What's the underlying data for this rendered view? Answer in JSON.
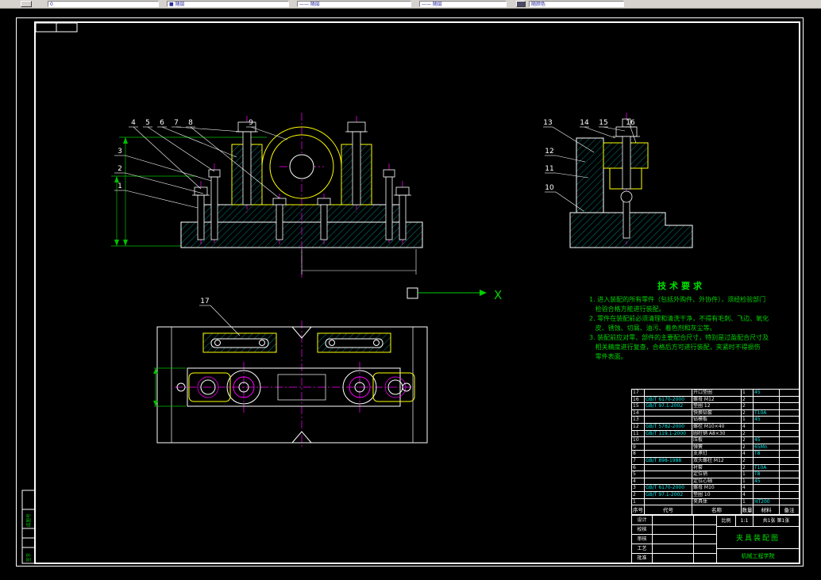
{
  "toolbar": {
    "layer": "0",
    "color": "■ 随层",
    "linetype": "—— 随层",
    "lineweight": "—— 随层",
    "plotstyle": "随颜色"
  },
  "ucs": {
    "x_label": "X"
  },
  "colors": {
    "outline": "#ffffff",
    "part": "#ffff00",
    "hatch": "#00e5e5",
    "centerline": "#ff00ff",
    "annotation": "#00d000"
  },
  "callouts": {
    "front": [
      "1",
      "2",
      "3",
      "4",
      "5",
      "6",
      "7",
      "8",
      "9"
    ],
    "side": [
      "10",
      "11",
      "12",
      "13",
      "14",
      "15",
      "16"
    ],
    "plan": [
      "17"
    ]
  },
  "tech": {
    "title": "技术要求",
    "lines": [
      "1. 进入装配的所有零件（包括外购件、外协件），须经检验部门",
      "   检验合格方能进行装配。",
      "2. 零件在装配前必须清理和清洗干净，不得有毛刺、飞边、氧化",
      "   皮、锈蚀、切屑、油污、着色剂和灰尘等。",
      "3. 装配前应对零、部件的主要配合尺寸，特别是过盈配合尺寸及",
      "   相关精度进行复查，合格后方可进行装配，夹紧时不得损伤",
      "   零件表面。"
    ]
  },
  "bom": {
    "headers": [
      "序号",
      "代号",
      "名称",
      "数量",
      "材料",
      "备注"
    ],
    "rows": [
      [
        "17",
        "",
        "开口垫圈",
        "1",
        "45",
        ""
      ],
      [
        "16",
        "GB/T 6170-2000",
        "螺母 M12",
        "2",
        "",
        ""
      ],
      [
        "15",
        "GB/T 97.1-2002",
        "垫圈 12",
        "2",
        "",
        ""
      ],
      [
        "14",
        "",
        "快换钻套",
        "2",
        "T10A",
        ""
      ],
      [
        "13",
        "",
        "钻模板",
        "1",
        "45",
        ""
      ],
      [
        "12",
        "GB/T 5782-2000",
        "螺栓 M10×40",
        "4",
        "",
        ""
      ],
      [
        "11",
        "GB/T 119.1-2000",
        "圆柱销 A8×30",
        "2",
        "",
        ""
      ],
      [
        "10",
        "",
        "压板",
        "2",
        "45",
        ""
      ],
      [
        "9",
        "",
        "弹簧",
        "2",
        "65Mn",
        ""
      ],
      [
        "8",
        "",
        "支承钉",
        "4",
        "T8",
        ""
      ],
      [
        "7",
        "GB/T 898-1988",
        "双头螺柱 M12",
        "2",
        "",
        ""
      ],
      [
        "6",
        "",
        "衬套",
        "2",
        "T10A",
        ""
      ],
      [
        "5",
        "",
        "定位销",
        "1",
        "T8",
        ""
      ],
      [
        "4",
        "",
        "定位心轴",
        "1",
        "45",
        ""
      ],
      [
        "3",
        "GB/T 6170-2000",
        "螺母 M10",
        "4",
        "",
        ""
      ],
      [
        "2",
        "GB/T 97.1-2002",
        "垫圈 10",
        "4",
        "",
        ""
      ],
      [
        "1",
        "",
        "夹具体",
        "1",
        "HT200",
        ""
      ]
    ]
  },
  "titleblock": {
    "sign_labels": [
      "设计",
      "校核",
      "审核",
      "工艺",
      "批准"
    ],
    "scale_label": "比例",
    "scale_value": "1:1",
    "sheet_text": "共1张 第1张",
    "title": "夹具装配图",
    "unit": "机械工程学院"
  },
  "left_margin": {
    "labels": [
      "底图号",
      "签字"
    ]
  }
}
